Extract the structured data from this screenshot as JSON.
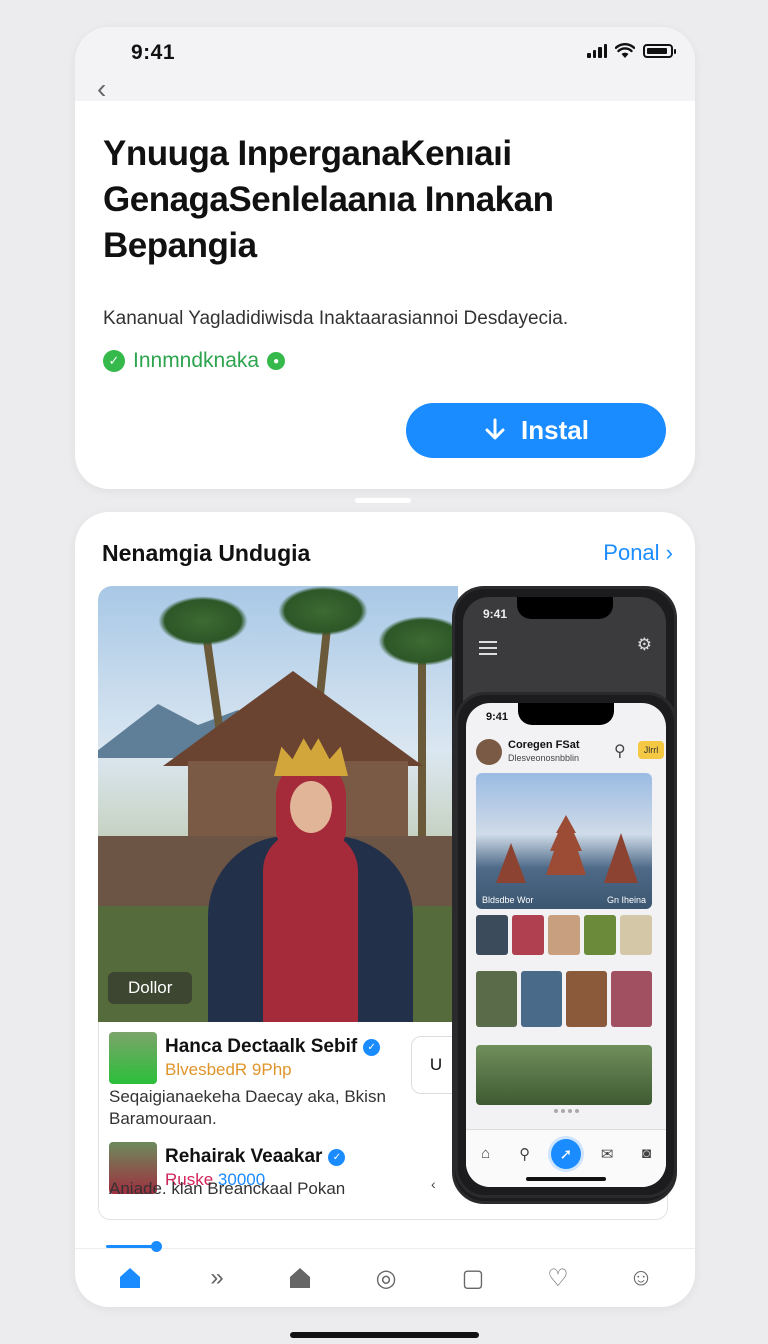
{
  "status_bar": {
    "time": "9:41"
  },
  "app": {
    "title": "Ynuuga InperganaKenıaıi GenagaSenlelaanıa Innakan Bepangia",
    "subtitle": "Kananual Yagladidiwisda Inaktaarasiannoi Desdayecia.",
    "verified_label": "Innmndknaka",
    "install_label": "Instal"
  },
  "section": {
    "title": "Nenamgia Undugia",
    "link": "Ponal ›"
  },
  "hero": {
    "tag": "Dollor"
  },
  "list": [
    {
      "title": "Hanca Dectaalk Sebif",
      "meta": "BlvesbedR 9Php",
      "meta_color": "#e0952a",
      "desc": "Seqaigianaekeha Daecay aka, Bkisn Baramouraan."
    },
    {
      "title": "Rehairak Veaakar",
      "meta_a": "Ruske",
      "meta_b": "30000",
      "desc": "Aniade. klan Breanckaal Pokan"
    }
  ],
  "side_button": "U",
  "phone_back": {
    "time": "9:41"
  },
  "phone_front": {
    "time": "9:41",
    "profile_name": "Coregen FSat",
    "profile_sub": "Dlesveonosnbblin",
    "badge": "Jlrrl",
    "hero_caption_left": "Bldsdbe Wor",
    "hero_caption_right": "Gn Iheina"
  },
  "colors": {
    "accent": "#1a8cff",
    "verified": "#2ea44f"
  }
}
